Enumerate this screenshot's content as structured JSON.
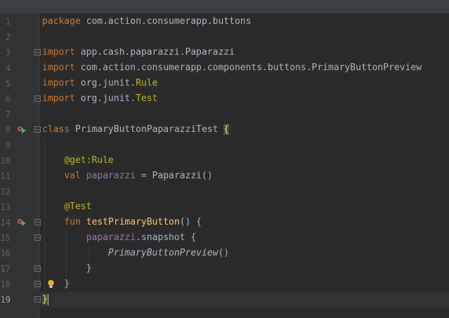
{
  "editor": {
    "language": "kotlin",
    "current_line": 19,
    "lines": [
      {
        "num": "1",
        "tokens": [
          {
            "t": "package ",
            "c": "kw"
          },
          {
            "t": "com.action.consumerapp.buttons",
            "c": ""
          }
        ]
      },
      {
        "num": "2",
        "tokens": []
      },
      {
        "num": "3",
        "tokens": [
          {
            "t": "import ",
            "c": "kw"
          },
          {
            "t": "app.cash.paparazzi.Paparazzi",
            "c": ""
          }
        ]
      },
      {
        "num": "4",
        "tokens": [
          {
            "t": "import ",
            "c": "kw"
          },
          {
            "t": "com.action.consumerapp.components.buttons.PrimaryButtonPreview",
            "c": ""
          }
        ]
      },
      {
        "num": "5",
        "tokens": [
          {
            "t": "import ",
            "c": "kw"
          },
          {
            "t": "org.junit.",
            "c": ""
          },
          {
            "t": "Rule",
            "c": "ann"
          }
        ]
      },
      {
        "num": "6",
        "tokens": [
          {
            "t": "import ",
            "c": "kw"
          },
          {
            "t": "org.junit.",
            "c": ""
          },
          {
            "t": "Test",
            "c": "ann"
          }
        ]
      },
      {
        "num": "7",
        "tokens": []
      },
      {
        "num": "8",
        "tokens": [
          {
            "t": "class ",
            "c": "kw"
          },
          {
            "t": "PrimaryButtonPaparazziTest ",
            "c": ""
          },
          {
            "t": "{",
            "c": "brace-match"
          }
        ]
      },
      {
        "num": "9",
        "tokens": []
      },
      {
        "num": "10",
        "tokens": [
          {
            "t": "    ",
            "c": ""
          },
          {
            "t": "@get:Rule",
            "c": "ann"
          }
        ]
      },
      {
        "num": "11",
        "tokens": [
          {
            "t": "    ",
            "c": ""
          },
          {
            "t": "val ",
            "c": "kw"
          },
          {
            "t": "paparazzi",
            "c": "prop"
          },
          {
            "t": " = Paparazzi()",
            "c": ""
          }
        ]
      },
      {
        "num": "12",
        "tokens": []
      },
      {
        "num": "13",
        "tokens": [
          {
            "t": "    ",
            "c": ""
          },
          {
            "t": "@Test",
            "c": "ann"
          }
        ]
      },
      {
        "num": "14",
        "tokens": [
          {
            "t": "    ",
            "c": ""
          },
          {
            "t": "fun ",
            "c": "kw"
          },
          {
            "t": "testPrimaryButton",
            "c": "fn"
          },
          {
            "t": "() {",
            "c": ""
          }
        ]
      },
      {
        "num": "15",
        "tokens": [
          {
            "t": "        ",
            "c": ""
          },
          {
            "t": "paparazzi",
            "c": "prop"
          },
          {
            "t": ".snapshot {",
            "c": ""
          }
        ]
      },
      {
        "num": "16",
        "tokens": [
          {
            "t": "            ",
            "c": ""
          },
          {
            "t": "PrimaryButtonPreview",
            "c": "italic"
          },
          {
            "t": "()",
            "c": ""
          }
        ]
      },
      {
        "num": "17",
        "tokens": [
          {
            "t": "        }",
            "c": ""
          }
        ]
      },
      {
        "num": "18",
        "tokens": [
          {
            "t": "    }",
            "c": ""
          }
        ]
      },
      {
        "num": "19",
        "tokens": [
          {
            "t": "}",
            "c": "brace-match"
          }
        ]
      }
    ],
    "folds": [
      3,
      6,
      8,
      14,
      15,
      17,
      18,
      19
    ],
    "run_icons": [
      8,
      14
    ],
    "bulb_icon": 18
  },
  "colors": {
    "background": "#2b2b2b",
    "gutter": "#313335",
    "keyword": "#cc7832",
    "annotation": "#bbb529",
    "property": "#9876aa",
    "function": "#ffc66d",
    "text": "#a9b7c6",
    "line_number": "#606366",
    "current_line": "#323232"
  }
}
